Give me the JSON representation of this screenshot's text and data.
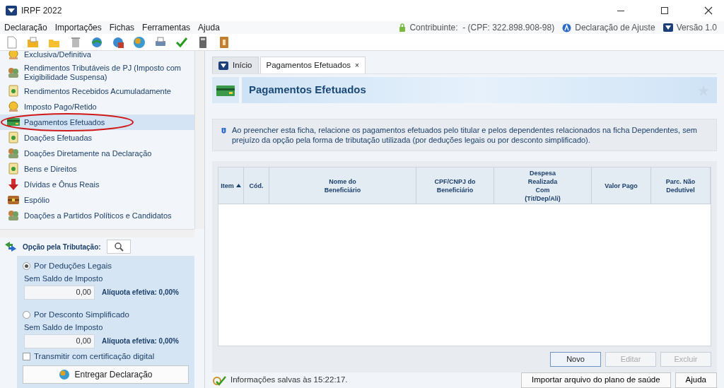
{
  "window": {
    "title": "IRPF 2022"
  },
  "menu": [
    "Declaração",
    "Importações",
    "Fichas",
    "Ferramentas",
    "Ajuda"
  ],
  "header_info": {
    "contributor": "Contribuinte:  - (CPF: 322.898.908-98)",
    "declaration": "Declaração de Ajuste",
    "version": "Versão 1.0"
  },
  "sidebar": {
    "items": [
      {
        "label": "Exclusiva/Definitiva",
        "kind": "coin",
        "selected": false,
        "circled": false
      },
      {
        "label": "Rendimentos Tributáveis de PJ (Imposto com Exigibilidade Suspensa)",
        "kind": "person",
        "selected": false,
        "circled": false
      },
      {
        "label": "Rendimentos Recebidos Acumuladamente",
        "kind": "doc",
        "selected": false,
        "circled": false
      },
      {
        "label": "Imposto Pago/Retido",
        "kind": "coin",
        "selected": false,
        "circled": false
      },
      {
        "label": "Pagamentos Efetuados",
        "kind": "card",
        "selected": true,
        "circled": true
      },
      {
        "label": "Doações Efetuadas",
        "kind": "doc",
        "selected": false,
        "circled": false
      },
      {
        "label": "Doações Diretamente na Declaração",
        "kind": "person",
        "selected": false,
        "circled": false
      },
      {
        "label": "Bens e Direitos",
        "kind": "doc",
        "selected": false,
        "circled": false
      },
      {
        "label": "Dívidas e Ônus Reais",
        "kind": "arrow",
        "selected": false,
        "circled": false
      },
      {
        "label": "Espólio",
        "kind": "chest",
        "selected": false,
        "circled": false
      },
      {
        "label": "Doações a Partidos Políticos e Candidatos",
        "kind": "person",
        "selected": false,
        "circled": false
      }
    ]
  },
  "taxation": {
    "title": "Opção pela Tributação:",
    "options": [
      {
        "label": "Por Deduções Legais",
        "selected": true,
        "sublabel": "Sem Saldo de Imposto",
        "value": "0,00",
        "rate": "Alíquota efetiva: 0,00%"
      },
      {
        "label": "Por Desconto Simplificado",
        "selected": false,
        "sublabel": "Sem Saldo de Imposto",
        "value": "0,00",
        "rate": "Alíquota efetiva: 0,00%"
      }
    ],
    "certificate": {
      "label": "Transmitir com certificação digital",
      "checked": false
    },
    "submit": "Entregar Declaração"
  },
  "tabs": [
    {
      "label": "Início",
      "selected": false
    },
    {
      "label": "Pagamentos Efetuados",
      "selected": true,
      "close": "×"
    }
  ],
  "page": {
    "title": "Pagamentos Efetuados",
    "info": "Ao preencher esta ficha, relacione os pagamentos efetuados pelo titular e pelos dependentes relacionados na ficha Dependentes, sem prejuízo da opção pela forma de tributação utilizada (por deduções legais ou por desconto simplificado)."
  },
  "table": {
    "columns": [
      {
        "label": "Item",
        "sorted": true
      },
      {
        "label": "Cód.",
        "sorted": false
      },
      {
        "label": "Nome do\nBeneficiário",
        "sorted": false
      },
      {
        "label": "CPF/CNPJ do\nBeneficiário",
        "sorted": false
      },
      {
        "label": "Despesa\nRealizada\nCom\n(Tit/Dep/Ali)",
        "sorted": false
      },
      {
        "label": "Valor Pago",
        "sorted": false
      },
      {
        "label": "Parc. Não\nDedutível",
        "sorted": false
      }
    ]
  },
  "buttons": [
    {
      "label": "Novo",
      "disabled": false
    },
    {
      "label": "Editar",
      "disabled": true
    },
    {
      "label": "Excluir",
      "disabled": true
    }
  ],
  "status_bar": {
    "message": "Informações salvas às 15:22:17.",
    "buttons": [
      "Importar arquivo do plano de saúde",
      "Ajuda"
    ]
  }
}
